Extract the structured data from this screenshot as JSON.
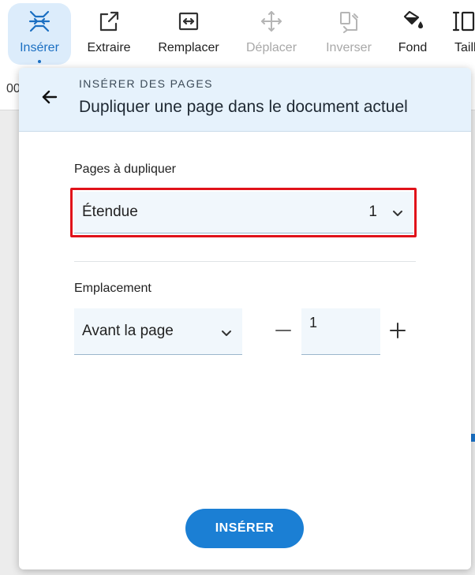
{
  "toolbar": {
    "items": [
      {
        "label": "Insérer",
        "icon": "insert-pages-icon",
        "state": "active"
      },
      {
        "label": "Extraire",
        "icon": "extract-icon",
        "state": "enabled"
      },
      {
        "label": "Remplacer",
        "icon": "replace-icon",
        "state": "enabled"
      },
      {
        "label": "Déplacer",
        "icon": "move-icon",
        "state": "disabled"
      },
      {
        "label": "Inverser",
        "icon": "reverse-icon",
        "state": "disabled"
      },
      {
        "label": "Fond",
        "icon": "fill-icon",
        "state": "enabled"
      },
      {
        "label": "Taill",
        "icon": "resize-icon",
        "state": "enabled"
      }
    ],
    "accent_color": "#1b6fc2"
  },
  "background": {
    "page_number": "00"
  },
  "dialog": {
    "overline": "INSÉRER DES PAGES",
    "title": "Dupliquer une page dans le document actuel",
    "pages_label": "Pages à dupliquer",
    "pages_select": {
      "value": "Étendue",
      "number": "1"
    },
    "location_label": "Emplacement",
    "location_select": {
      "value": "Avant la page"
    },
    "page_input": {
      "value": "1"
    },
    "insert_button": "INSÉRER",
    "highlight_color": "#e0121a",
    "button_color": "#1b7fd4"
  }
}
